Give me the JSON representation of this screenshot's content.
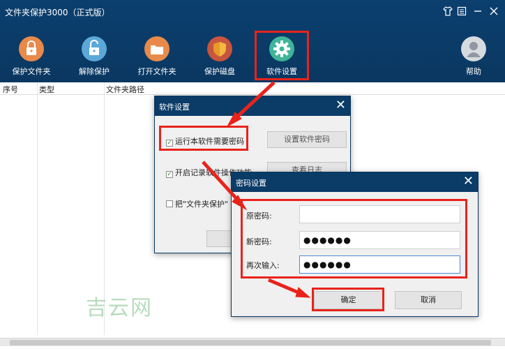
{
  "app": {
    "title": "文件夹保护3000（正式版）"
  },
  "window_controls": [
    {
      "name": "skin-icon",
      "glyph": "👕"
    },
    {
      "name": "menu-icon",
      "glyph": "☰"
    },
    {
      "name": "minimize-icon",
      "glyph": "—"
    },
    {
      "name": "close-icon",
      "glyph": "✕"
    }
  ],
  "toolbar": {
    "protect_folder": "保护文件夹",
    "unprotect": "解除保护",
    "open_folder": "打开文件夹",
    "protect_disk": "保护磁盘",
    "settings": "软件设置",
    "help": "帮助"
  },
  "table": {
    "columns": [
      "序号",
      "类型",
      "文件夹路径"
    ]
  },
  "settings_dialog": {
    "title": "软件设置",
    "opt_require_password": "运行本软件需要密码",
    "opt_enable_log": "开启记录软件操作功能",
    "opt_context": "把\"文件夹保护\"",
    "btn_set_password": "设置软件密码",
    "btn_view_log": "查看日志"
  },
  "password_dialog": {
    "title": "密码设置",
    "label_old": "原密码:",
    "label_new": "新密码:",
    "label_confirm": "再次输入:",
    "old_value": "",
    "new_value": "●●●●●●",
    "confirm_value": "●●●●●●",
    "btn_ok": "确定",
    "btn_cancel": "取消"
  },
  "watermark": "吉云网",
  "colors": {
    "header_bg": "#0b3b67",
    "highlight": "#e8231b",
    "dialog_bg": "#f0f0f0"
  }
}
